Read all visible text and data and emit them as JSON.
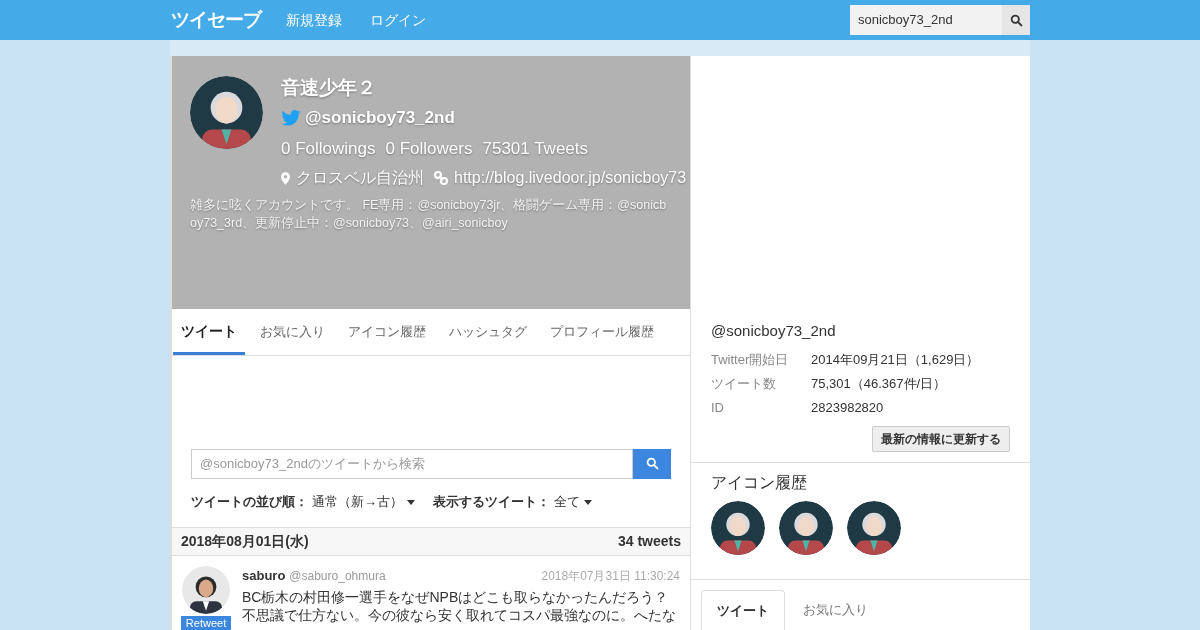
{
  "header": {
    "logo": "ツイセーブ",
    "nav": [
      "新規登録",
      "ログイン"
    ],
    "search": {
      "value": "sonicboy73_2nd"
    }
  },
  "profile": {
    "name": "音速少年２",
    "handle": "@sonicboy73_2nd",
    "stats": [
      {
        "count": "0",
        "label": "Followings"
      },
      {
        "count": "0",
        "label": "Followers"
      },
      {
        "count": "75301",
        "label": "Tweets"
      }
    ],
    "location": "クロスベル自治州",
    "url": "http://blog.livedoor.jp/sonicboy73",
    "bio": "雑多に呟くアカウントです。 FE専用：@sonicboy73jr、格闘ゲーム専用：@sonicboy73_3rd、更新停止中：@sonicboy73、@airi_sonicboy"
  },
  "tabs": [
    {
      "label": "ツイート",
      "selected": true
    },
    {
      "label": "お気に入り",
      "selected": false
    },
    {
      "label": "アイコン履歴",
      "selected": false
    },
    {
      "label": "ハッシュタグ",
      "selected": false
    },
    {
      "label": "プロフィール履歴",
      "selected": false
    }
  ],
  "tweet_search": {
    "placeholder": "@sonicboy73_2ndのツイートから検索"
  },
  "filters": [
    {
      "label": "ツイートの並び順：",
      "value": "通常（新→古）"
    },
    {
      "label": "表示するツイート：",
      "value": "全て"
    }
  ],
  "day": {
    "date": "2018年08月01日(水)",
    "count": "34 tweets"
  },
  "tweets": [
    {
      "name": "saburo",
      "handle": "@saburo_ohmura",
      "time": "2018年07月31日 11:30:24",
      "badge": "Retweet",
      "text": "BC栃木の村田修一選手をなぜNPBはどこも取らなかったんだろう？不思議で仕方ない。今の彼なら安く取れてコスパ最強なのに。へたな"
    }
  ],
  "info": {
    "handle": "@sonicboy73_2nd",
    "rows": [
      {
        "label": "Twitter開始日",
        "value": "2014年09月21日（1,629日）"
      },
      {
        "label": "ツイート数",
        "value": "75,301（46.367件/日）"
      },
      {
        "label": "ID",
        "value": "2823982820"
      }
    ],
    "refresh_button": "最新の情報に更新する"
  },
  "icon_history": {
    "title": "アイコン履歴"
  },
  "side_tabs": [
    {
      "label": "ツイート",
      "selected": true
    },
    {
      "label": "お気に入り",
      "selected": false
    }
  ]
}
